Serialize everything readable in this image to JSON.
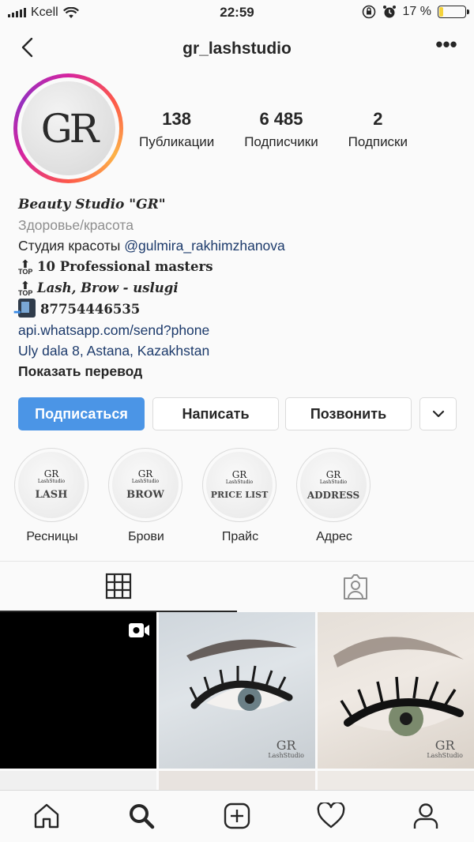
{
  "status_bar": {
    "carrier": "Kcell",
    "time": "22:59",
    "battery": "17 %",
    "battery_level": 0.17
  },
  "header": {
    "username": "gr_lashstudio",
    "back_icon": "chevron-left-icon",
    "more_icon": "more-horizontal-icon",
    "more_label": "•••"
  },
  "profile": {
    "avatar_text": "GR",
    "stats": [
      {
        "value": "138",
        "label": "Публикации"
      },
      {
        "value": "6 485",
        "label": "Подписчики"
      },
      {
        "value": "2",
        "label": "Подписки"
      }
    ]
  },
  "bio": {
    "name": "Beauty Studio \"GR\"",
    "category": "Здоровье/красота",
    "line_studio_prefix": "Студия красоты ",
    "mention": "@gulmira_rakhimzhanova",
    "top_label": "TOP",
    "line_masters": "10 Professional masters",
    "line_services": "Lash, Brow - uslugi",
    "phone": "87754446535",
    "link": "api.whatsapp.com/send?phone",
    "address": "Uly dala 8, Astana, Kazakhstan",
    "translate": "Показать перевод"
  },
  "buttons": {
    "follow": "Подписаться",
    "message": "Написать",
    "call": "Позвонить",
    "more_icon": "chevron-down-icon"
  },
  "highlights": [
    {
      "cover": "LASH",
      "label": "Ресницы"
    },
    {
      "cover": "BROW",
      "label": "Брови"
    },
    {
      "cover": "PRICE LIST",
      "label": "Прайс"
    },
    {
      "cover": "ADDRESS",
      "label": "Адрес"
    }
  ],
  "highlight_logo": {
    "gr": "GR",
    "studio": "LashStudio"
  },
  "tabs": [
    {
      "name": "grid",
      "icon": "grid-icon",
      "active": true
    },
    {
      "name": "tagged",
      "icon": "tagged-icon",
      "active": false
    }
  ],
  "posts": [
    {
      "kind": "video",
      "icon": "video-icon"
    },
    {
      "kind": "photo",
      "watermark_gr": "GR",
      "watermark_studio": "LashStudio"
    },
    {
      "kind": "photo",
      "watermark_gr": "GR",
      "watermark_studio": "LashStudio"
    }
  ],
  "bottom_nav": [
    {
      "name": "home",
      "icon": "home-icon"
    },
    {
      "name": "search",
      "icon": "search-icon"
    },
    {
      "name": "new-post",
      "icon": "plus-square-icon"
    },
    {
      "name": "activity",
      "icon": "heart-icon"
    },
    {
      "name": "profile",
      "icon": "person-icon"
    }
  ],
  "colors": {
    "follow_button": "#4b95e6",
    "mention": "#1c3a6b",
    "battery_fill": "#f5d33a"
  }
}
